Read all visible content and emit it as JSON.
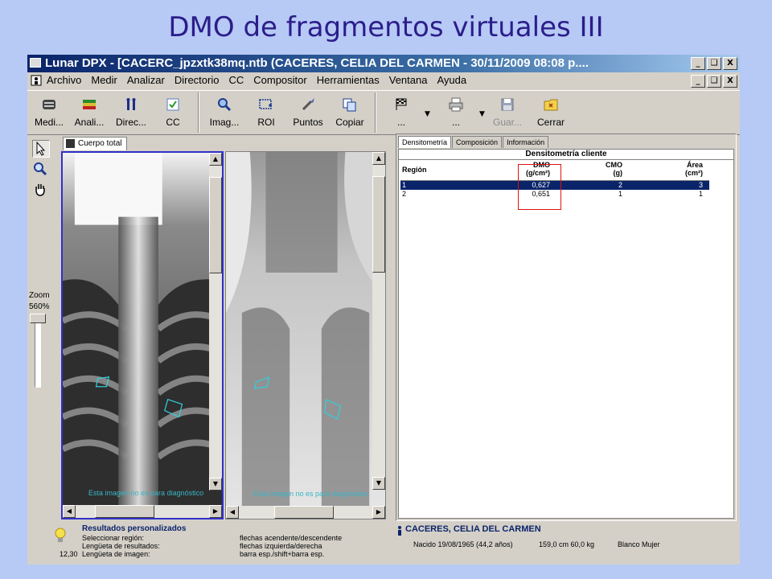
{
  "slide": {
    "title": "DMO de fragmentos virtuales III"
  },
  "window": {
    "title": "Lunar DPX - [CACERC_jpzxtk38mq.ntb (CACERES, CELIA DEL CARMEN - 30/11/2009 08:08 p....",
    "controls": [
      "_",
      "❑",
      "X"
    ]
  },
  "menu": {
    "items": [
      "Archivo",
      "Medir",
      "Analizar",
      "Directorio",
      "CC",
      "Compositor",
      "Herramientas",
      "Ventana",
      "Ayuda"
    ]
  },
  "toolbar": {
    "buttons": [
      {
        "label": "Medi...",
        "icon": "measure-icon",
        "enabled": true
      },
      {
        "label": "Anali...",
        "icon": "analyze-icon",
        "enabled": true
      },
      {
        "label": "Direc...",
        "icon": "directory-icon",
        "enabled": true
      },
      {
        "label": "CC",
        "icon": "cc-icon",
        "enabled": true
      },
      {
        "label": "Imag...",
        "icon": "image-magnify-icon",
        "enabled": true
      },
      {
        "label": "ROI",
        "icon": "roi-icon",
        "enabled": true
      },
      {
        "label": "Puntos",
        "icon": "points-icon",
        "enabled": true
      },
      {
        "label": "Copiar",
        "icon": "copy-icon",
        "enabled": true
      },
      {
        "label": "...",
        "icon": "flag-icon",
        "enabled": true
      },
      {
        "label": "...",
        "icon": "printer-icon",
        "enabled": true
      },
      {
        "label": "Guar...",
        "icon": "save-icon",
        "enabled": false
      },
      {
        "label": "Cerrar",
        "icon": "close-folder-icon",
        "enabled": true
      }
    ]
  },
  "tools": {
    "items": [
      "pointer-icon",
      "zoom-icon",
      "hand-icon"
    ],
    "zoom_label": "Zoom",
    "zoom_value": "560%"
  },
  "image_panel": {
    "tab_label": "Cuerpo total",
    "disclaimer": "Esta imagen no es para diagnóstico"
  },
  "results": {
    "tabs": [
      "Densitometría",
      "Composición",
      "Información"
    ],
    "header": "Densitometría cliente",
    "columns": [
      {
        "name": "Región",
        "unit": ""
      },
      {
        "name": "DMO",
        "unit": "(g/cm²)"
      },
      {
        "name": "CMO",
        "unit": "(g)"
      },
      {
        "name": "Área",
        "unit": "(cm²)"
      }
    ],
    "rows": [
      {
        "region": "1",
        "dmo": "0,627",
        "cmo": "2",
        "area": "3",
        "selected": true
      },
      {
        "region": "2",
        "dmo": "0,651",
        "cmo": "1",
        "area": "1",
        "selected": false
      }
    ],
    "highlight_color": "#e01010"
  },
  "status": {
    "title": "Resultados personalizados",
    "lines": [
      "Seleccionar región:",
      "Lengüeta de resultados:",
      "Lengüeta de imagen:"
    ],
    "value": "12,30",
    "hints": [
      "flechas acendente/descendente",
      "flechas izquierda/derecha",
      "barra esp./shift+barra esp."
    ]
  },
  "patient": {
    "name": "CACERES, CELIA DEL CARMEN",
    "born": "Nacido 19/08/1965 (44,2 años)",
    "measures": "159,0 cm 60,0 kg",
    "group": "Blanco Mujer"
  },
  "colors": {
    "background": "#b7c9f5",
    "title": "#2b1d8a",
    "titlebar": "#0a246a",
    "selection": "#0a246a"
  }
}
